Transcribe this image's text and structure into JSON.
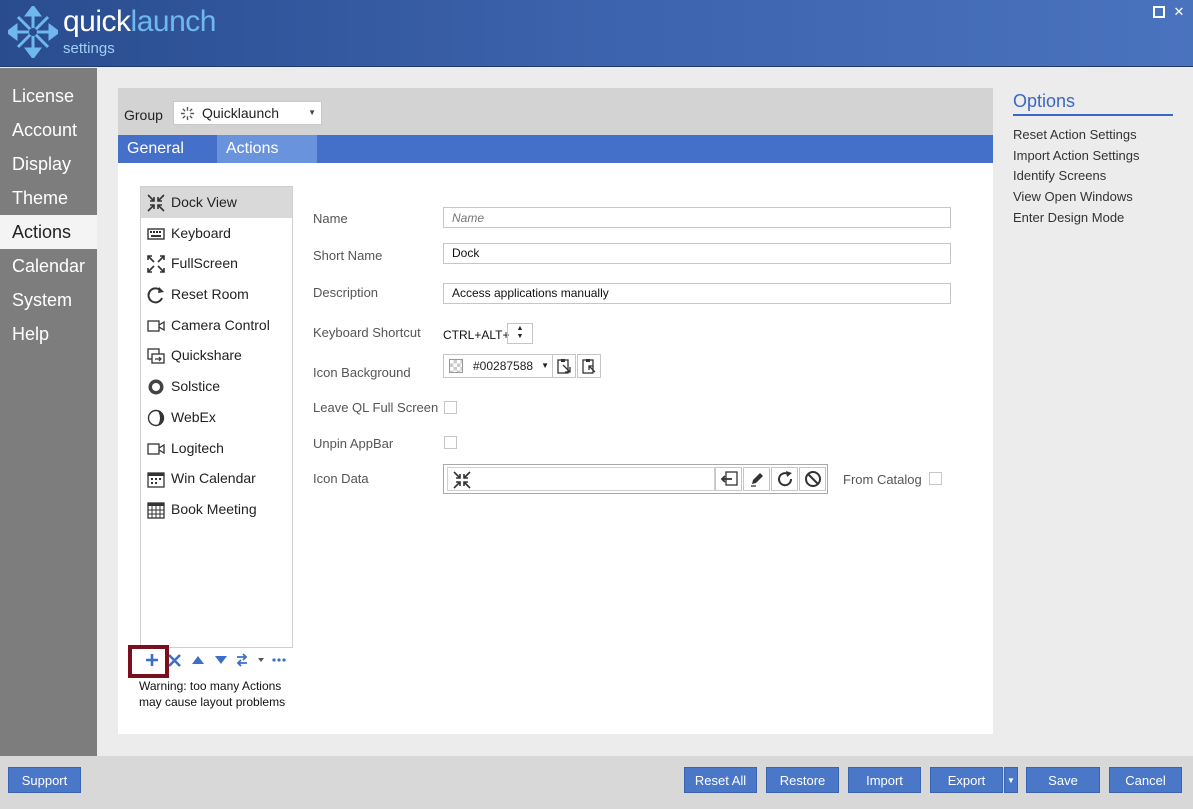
{
  "app": {
    "title_a": "quick",
    "title_b": "launch",
    "subtitle": "settings"
  },
  "colors": {
    "accent": "#4470c9",
    "header": "#2f539a",
    "nav_bg": "#7d7d7d",
    "highlight": "#7a0f1e"
  },
  "nav": {
    "items": [
      {
        "label": "License"
      },
      {
        "label": "Account"
      },
      {
        "label": "Display"
      },
      {
        "label": "Theme"
      },
      {
        "label": "Actions",
        "active": true
      },
      {
        "label": "Calendar"
      },
      {
        "label": "System"
      },
      {
        "label": "Help"
      }
    ]
  },
  "group": {
    "label": "Group",
    "value": "Quicklaunch"
  },
  "tabs": [
    {
      "label": "General"
    },
    {
      "label": "Actions",
      "active": true
    }
  ],
  "actions": [
    {
      "label": "Dock View",
      "icon": "dock-icon",
      "selected": true
    },
    {
      "label": "Keyboard",
      "icon": "keyboard-icon"
    },
    {
      "label": "FullScreen",
      "icon": "fullscreen-icon"
    },
    {
      "label": "Reset Room",
      "icon": "reset-icon"
    },
    {
      "label": "Camera Control",
      "icon": "camera-icon"
    },
    {
      "label": "Quickshare",
      "icon": "share-icon"
    },
    {
      "label": "Solstice",
      "icon": "solstice-icon"
    },
    {
      "label": "WebEx",
      "icon": "webex-icon"
    },
    {
      "label": "Logitech",
      "icon": "camera-icon"
    },
    {
      "label": "Win Calendar",
      "icon": "calendar-icon"
    },
    {
      "label": "Book Meeting",
      "icon": "grid-calendar-icon"
    }
  ],
  "warning": "Warning: too many Actions may cause layout problems",
  "form": {
    "name_label": "Name",
    "name_placeholder": "Name",
    "shortname_label": "Short Name",
    "shortname_value": "Dock",
    "description_label": "Description",
    "description_value": "Access applications manually",
    "shortcut_label": "Keyboard Shortcut",
    "shortcut_value": "CTRL+ALT+",
    "iconbg_label": "Icon Background",
    "iconbg_value": "#00287588",
    "leavefull_label": "Leave QL Full Screen",
    "leavefull_checked": false,
    "unpin_label": "Unpin AppBar",
    "unpin_checked": false,
    "icondata_label": "Icon Data",
    "fromcatalog_label": "From Catalog",
    "fromcatalog_checked": false
  },
  "options": {
    "title": "Options",
    "links": [
      "Reset Action Settings",
      "Import Action Settings",
      "Identify Screens",
      "View Open Windows",
      "Enter Design Mode"
    ]
  },
  "footer": {
    "support": "Support",
    "reset_all": "Reset All",
    "restore": "Restore",
    "import": "Import",
    "export": "Export",
    "save": "Save",
    "cancel": "Cancel"
  }
}
